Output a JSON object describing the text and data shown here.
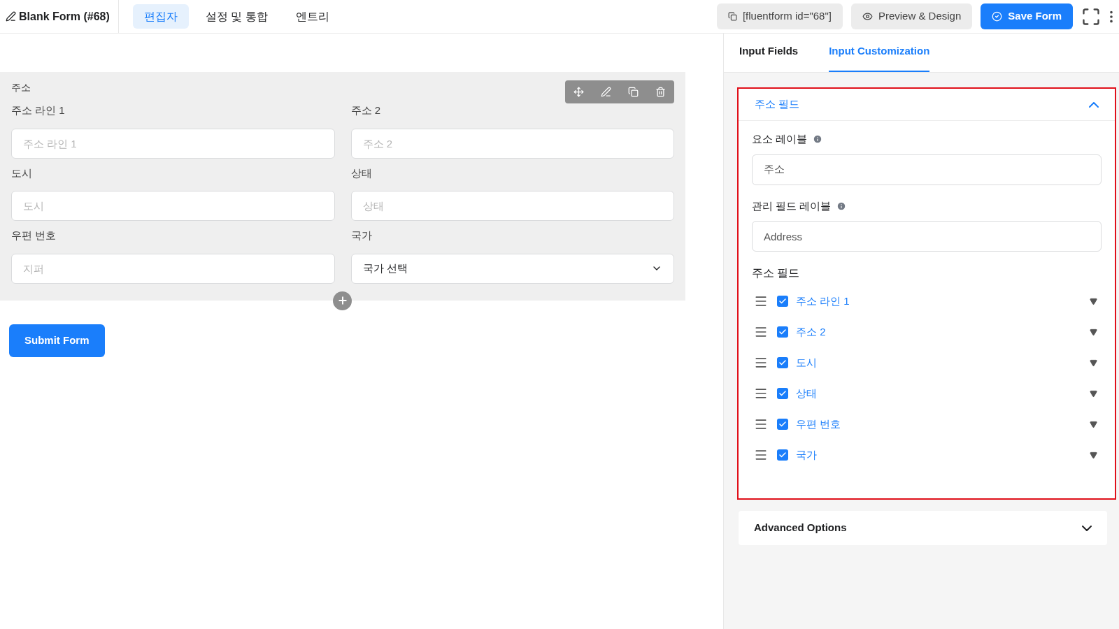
{
  "header": {
    "title": "Blank Form (#68)",
    "tabs": [
      {
        "label": "편집자",
        "selected": true
      },
      {
        "label": "설정 및 통합",
        "selected": false
      },
      {
        "label": "엔트리",
        "selected": false
      }
    ],
    "shortcode": "[fluentform id=\"68\"]",
    "preview": "Preview & Design",
    "save": "Save Form"
  },
  "form": {
    "group_label": "주소",
    "fields": [
      {
        "label": "주소 라인 1",
        "placeholder": "주소 라인 1",
        "kind": "text"
      },
      {
        "label": "주소 2",
        "placeholder": "주소 2",
        "kind": "text"
      },
      {
        "label": "도시",
        "placeholder": "도시",
        "kind": "text"
      },
      {
        "label": "상태",
        "placeholder": "상태",
        "kind": "text"
      },
      {
        "label": "우편 번호",
        "placeholder": "지퍼",
        "kind": "text"
      },
      {
        "label": "국가",
        "placeholder": "국가 선택",
        "kind": "select"
      }
    ],
    "submit": "Submit Form"
  },
  "panel": {
    "tabs": [
      {
        "label": "Input Fields",
        "selected": false
      },
      {
        "label": "Input Customization",
        "selected": true
      }
    ],
    "section": {
      "title": "주소 필드",
      "expanded": true,
      "element_label": {
        "label": "요소 레이블",
        "value": "주소"
      },
      "admin_label": {
        "label": "관리 필드 레이블",
        "value": "Address"
      },
      "subfields_title": "주소 필드",
      "subfields": [
        {
          "label": "주소 라인 1",
          "checked": true
        },
        {
          "label": "주소 2",
          "checked": true
        },
        {
          "label": "도시",
          "checked": true
        },
        {
          "label": "상태",
          "checked": true
        },
        {
          "label": "우편 번호",
          "checked": true
        },
        {
          "label": "국가",
          "checked": true
        }
      ]
    },
    "advanced": {
      "title": "Advanced Options",
      "expanded": false
    }
  }
}
